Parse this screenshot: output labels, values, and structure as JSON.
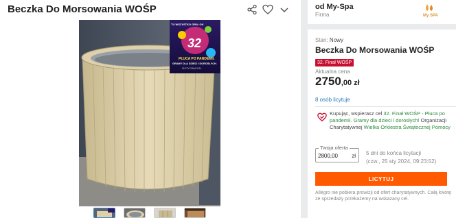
{
  "product": {
    "title": "Beczka Do Morsowania WOŚP",
    "condition_label": "Stan:",
    "condition_value": "Nowy",
    "badge": "32. Finał WOŚP",
    "price_label": "Aktualna cena",
    "price_int": "2750",
    "price_dec": ",00 zł",
    "bidders": "8 osób licytuje"
  },
  "actions": {
    "share": "share-icon",
    "favorite": "heart-icon",
    "expand": "chevron-down-icon"
  },
  "photo": {
    "poster_line1": "TU WSZYSTKO GRA! OK",
    "poster_number": "32",
    "poster_title": "PŁUCA PO PANDEMII.",
    "poster_sub": "GRAMY DLA DZIECI I DOROSŁYCH.",
    "poster_date": "28 STYCZNIA 2024"
  },
  "thumbnails": [
    "thumb-1",
    "thumb-2",
    "thumb-3",
    "thumb-4"
  ],
  "seller": {
    "name": "od My-Spa",
    "type": "Firma",
    "logo_text": "My SPA"
  },
  "charity": {
    "pre": "Kupując, wspierasz cel ",
    "cause": "32. Finał WOŚP - Płuca po pandemii. Gramy dla dzieci i dorosłych!",
    "org_pre": " Organizacji Charytatywnej ",
    "org": "Wielka Orkiestra Świątecznej Pomocy"
  },
  "bid": {
    "label": "Twoja oferta",
    "value": "2800,00",
    "currency": "zł",
    "time_left": "5 dni do końca licytacji",
    "end_date": "(czw., 25 sty 2024, 09:23:52)",
    "button": "LICYTUJ"
  },
  "note": "Allegro nie pobiera prowizji od ofert charytatywnych. Całą kwotę ze sprzedaży przekażemy na wskazany cel.",
  "colors": {
    "accent": "#ff5a00",
    "badge": "#c8102e",
    "link": "#2a7ab8",
    "charity_link": "#2c8a3c"
  }
}
